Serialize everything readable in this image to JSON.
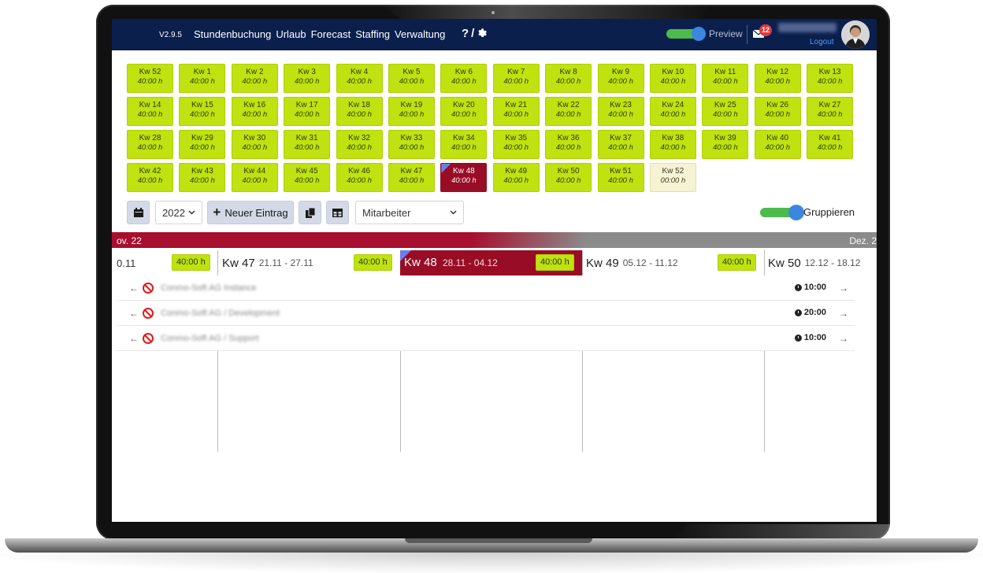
{
  "navbar": {
    "version": "V2.9.5",
    "links": [
      "Stundenbuchung",
      "Urlaub",
      "Forecast",
      "Staffing",
      "Verwaltung"
    ],
    "help_label": "?",
    "separator": "/",
    "preview_label": "Preview",
    "mail_count": "12",
    "logout_label": "Logout"
  },
  "weeks": [
    {
      "label": "Kw 52",
      "hours": "40:00 h"
    },
    {
      "label": "Kw 1",
      "hours": "40:00 h"
    },
    {
      "label": "Kw 2",
      "hours": "40:00 h"
    },
    {
      "label": "Kw 3",
      "hours": "40:00 h"
    },
    {
      "label": "Kw 4",
      "hours": "40:00 h"
    },
    {
      "label": "Kw 5",
      "hours": "40:00 h"
    },
    {
      "label": "Kw 6",
      "hours": "40:00 h"
    },
    {
      "label": "Kw 7",
      "hours": "40:00 h"
    },
    {
      "label": "Kw 8",
      "hours": "40:00 h"
    },
    {
      "label": "Kw 9",
      "hours": "40:00 h"
    },
    {
      "label": "Kw 10",
      "hours": "40:00 h"
    },
    {
      "label": "Kw 11",
      "hours": "40:00 h"
    },
    {
      "label": "Kw 12",
      "hours": "40:00 h"
    },
    {
      "label": "Kw 13",
      "hours": "40:00 h"
    },
    {
      "label": "Kw 14",
      "hours": "40:00 h"
    },
    {
      "label": "Kw 15",
      "hours": "40:00 h"
    },
    {
      "label": "Kw 16",
      "hours": "40:00 h"
    },
    {
      "label": "Kw 17",
      "hours": "40:00 h"
    },
    {
      "label": "Kw 18",
      "hours": "40:00 h"
    },
    {
      "label": "Kw 19",
      "hours": "40:00 h"
    },
    {
      "label": "Kw 20",
      "hours": "40:00 h"
    },
    {
      "label": "Kw 21",
      "hours": "40:00 h"
    },
    {
      "label": "Kw 22",
      "hours": "40:00 h"
    },
    {
      "label": "Kw 23",
      "hours": "40:00 h"
    },
    {
      "label": "Kw 24",
      "hours": "40:00 h"
    },
    {
      "label": "Kw 25",
      "hours": "40:00 h"
    },
    {
      "label": "Kw 26",
      "hours": "40:00 h"
    },
    {
      "label": "Kw 27",
      "hours": "40:00 h"
    },
    {
      "label": "Kw 28",
      "hours": "40:00 h"
    },
    {
      "label": "Kw 29",
      "hours": "40:00 h"
    },
    {
      "label": "Kw 30",
      "hours": "40:00 h"
    },
    {
      "label": "Kw 31",
      "hours": "40:00 h"
    },
    {
      "label": "Kw 32",
      "hours": "40:00 h"
    },
    {
      "label": "Kw 33",
      "hours": "40:00 h"
    },
    {
      "label": "Kw 34",
      "hours": "40:00 h"
    },
    {
      "label": "Kw 35",
      "hours": "40:00 h"
    },
    {
      "label": "Kw 36",
      "hours": "40:00 h"
    },
    {
      "label": "Kw 37",
      "hours": "40:00 h"
    },
    {
      "label": "Kw 38",
      "hours": "40:00 h"
    },
    {
      "label": "Kw 39",
      "hours": "40:00 h"
    },
    {
      "label": "Kw 40",
      "hours": "40:00 h"
    },
    {
      "label": "Kw 41",
      "hours": "40:00 h"
    },
    {
      "label": "Kw 42",
      "hours": "40:00 h"
    },
    {
      "label": "Kw 43",
      "hours": "40:00 h"
    },
    {
      "label": "Kw 44",
      "hours": "40:00 h"
    },
    {
      "label": "Kw 45",
      "hours": "40:00 h"
    },
    {
      "label": "Kw 46",
      "hours": "40:00 h"
    },
    {
      "label": "Kw 47",
      "hours": "40:00 h"
    },
    {
      "label": "Kw 48",
      "hours": "40:00 h",
      "state": "current"
    },
    {
      "label": "Kw 49",
      "hours": "40:00 h"
    },
    {
      "label": "Kw 50",
      "hours": "40:00 h"
    },
    {
      "label": "Kw 51",
      "hours": "40:00 h"
    },
    {
      "label": "Kw 52",
      "hours": "00:00 h",
      "state": "empty"
    }
  ],
  "toolbar": {
    "year": "2022",
    "new_entry_label": "Neuer Eintrag",
    "filter_value": "Mitarbeiter",
    "group_label": "Gruppieren"
  },
  "timeline": {
    "month_left": "ov. 22",
    "month_right": "Dez. 2",
    "week_prev_tail": "0.11",
    "weeks": [
      {
        "kw": "Kw 47",
        "range": "21.11 - 27.11",
        "hours": "40:00 h"
      },
      {
        "kw": "Kw 48",
        "range": "28.11 - 04.12",
        "hours": "40:00 h"
      },
      {
        "kw": "Kw 49",
        "range": "05.12 - 11.12",
        "hours": "40:00 h"
      },
      {
        "kw": "Kw 50",
        "range": "12.12 - 18.12",
        "hours": "40:00 h"
      }
    ],
    "entries": [
      {
        "name": "Conmo-Soft AG Instance",
        "time": "10:00"
      },
      {
        "name": "Conmo-Soft AG / Development",
        "time": "20:00"
      },
      {
        "name": "Conmo-Soft AG / Support",
        "time": "10:00"
      }
    ]
  },
  "colors": {
    "navbar": "#0b1f4d",
    "week_done": "#bfe210",
    "week_current": "#990c25",
    "week_empty": "#f5f3d2",
    "toggle_on": "#4cbb4c",
    "knob": "#3b87e0"
  }
}
